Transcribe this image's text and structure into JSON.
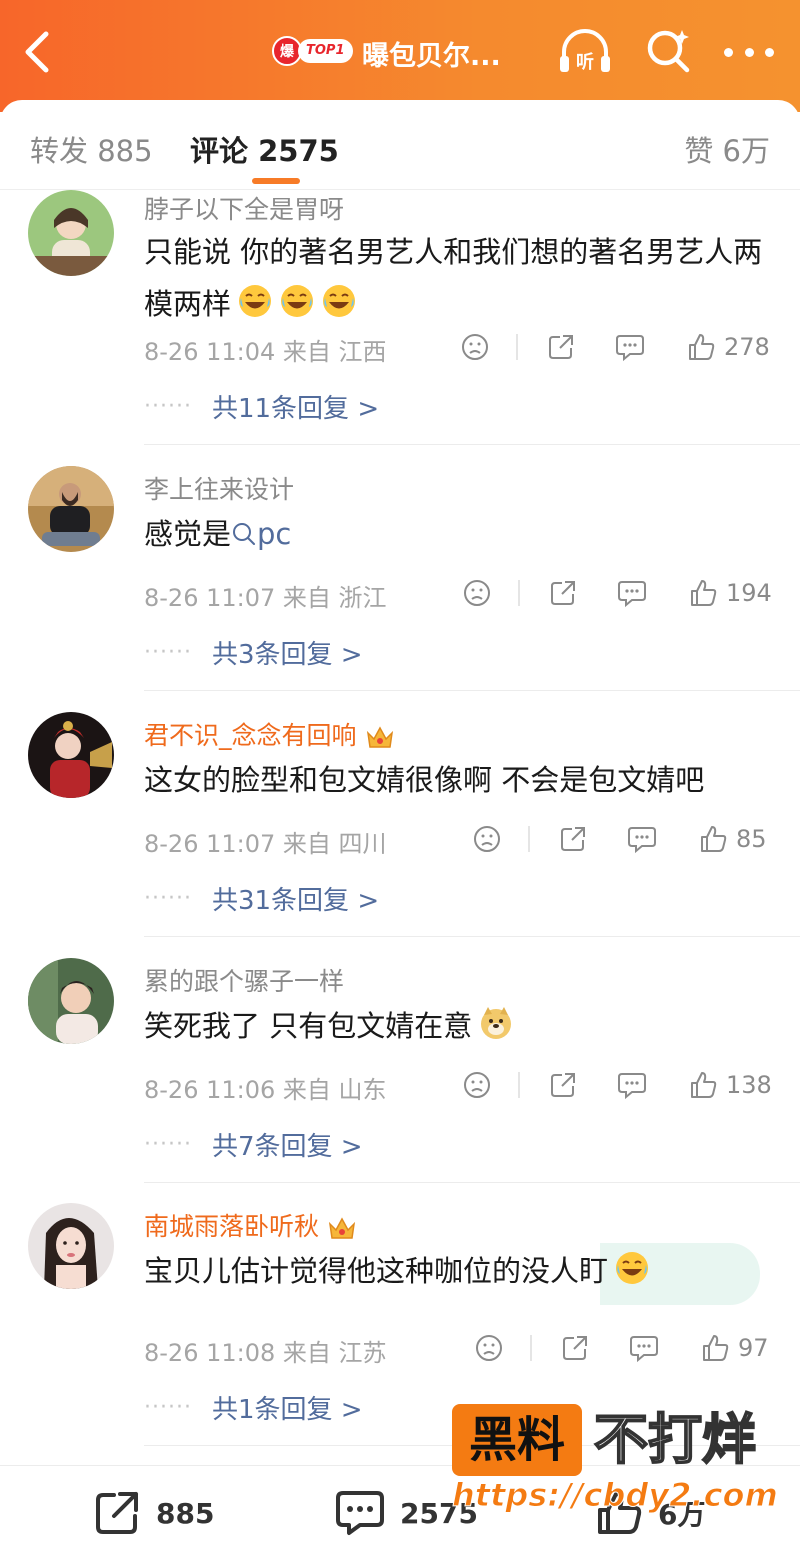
{
  "header": {
    "badge_fire": "爆",
    "badge_top": "TOP1",
    "title": "曝包贝尔...",
    "listen_label": "听"
  },
  "tabs": {
    "repost": "转发 885",
    "comment": "评论 2575",
    "like": "赞 6万"
  },
  "comments": [
    {
      "username": "脖子以下全是胃呀",
      "text": "只能说 你的著名男艺人和我们想的著名男艺人两模两样",
      "time": "8-26 11:04",
      "location": "来自 江西",
      "likes": "278",
      "replies": "共11条回复 >"
    },
    {
      "username": "李上往来设计",
      "text_prefix": "感觉是",
      "search_tag": "pc",
      "time": "8-26 11:07",
      "location": "来自 浙江",
      "likes": "194",
      "replies": "共3条回复 >"
    },
    {
      "username": "君不识_念念有回响",
      "text": "这女的脸型和包文婧很像啊   不会是包文婧吧",
      "time": "8-26 11:07",
      "location": "来自 四川",
      "likes": "85",
      "replies": "共31条回复 >"
    },
    {
      "username": "累的跟个骡子一样",
      "text": "笑死我了 只有包文婧在意",
      "time": "8-26 11:06",
      "location": "来自 山东",
      "likes": "138",
      "replies": "共7条回复 >"
    },
    {
      "username": "南城雨落卧听秋",
      "text": "宝贝儿估计觉得他这种咖位的没人盯",
      "time": "8-26 11:08",
      "location": "来自 江苏",
      "likes": "97",
      "replies": "共1条回复 >"
    }
  ],
  "bottom_bar": {
    "repost_count": "885",
    "comment_count": "2575",
    "like_count": "6万"
  },
  "watermark": {
    "box": "黑料",
    "rest": "不打烊",
    "url": "https://cbdy2.com"
  },
  "colors": {
    "header_orange": "#f7662a",
    "accent": "#f77b27",
    "link_blue": "#526c9c",
    "vip_orange": "#ef6a1c"
  },
  "icons": [
    "back-icon",
    "listen-icon",
    "search-icon",
    "more-icon",
    "dislike-icon",
    "share-icon",
    "comment-icon",
    "like-icon"
  ]
}
